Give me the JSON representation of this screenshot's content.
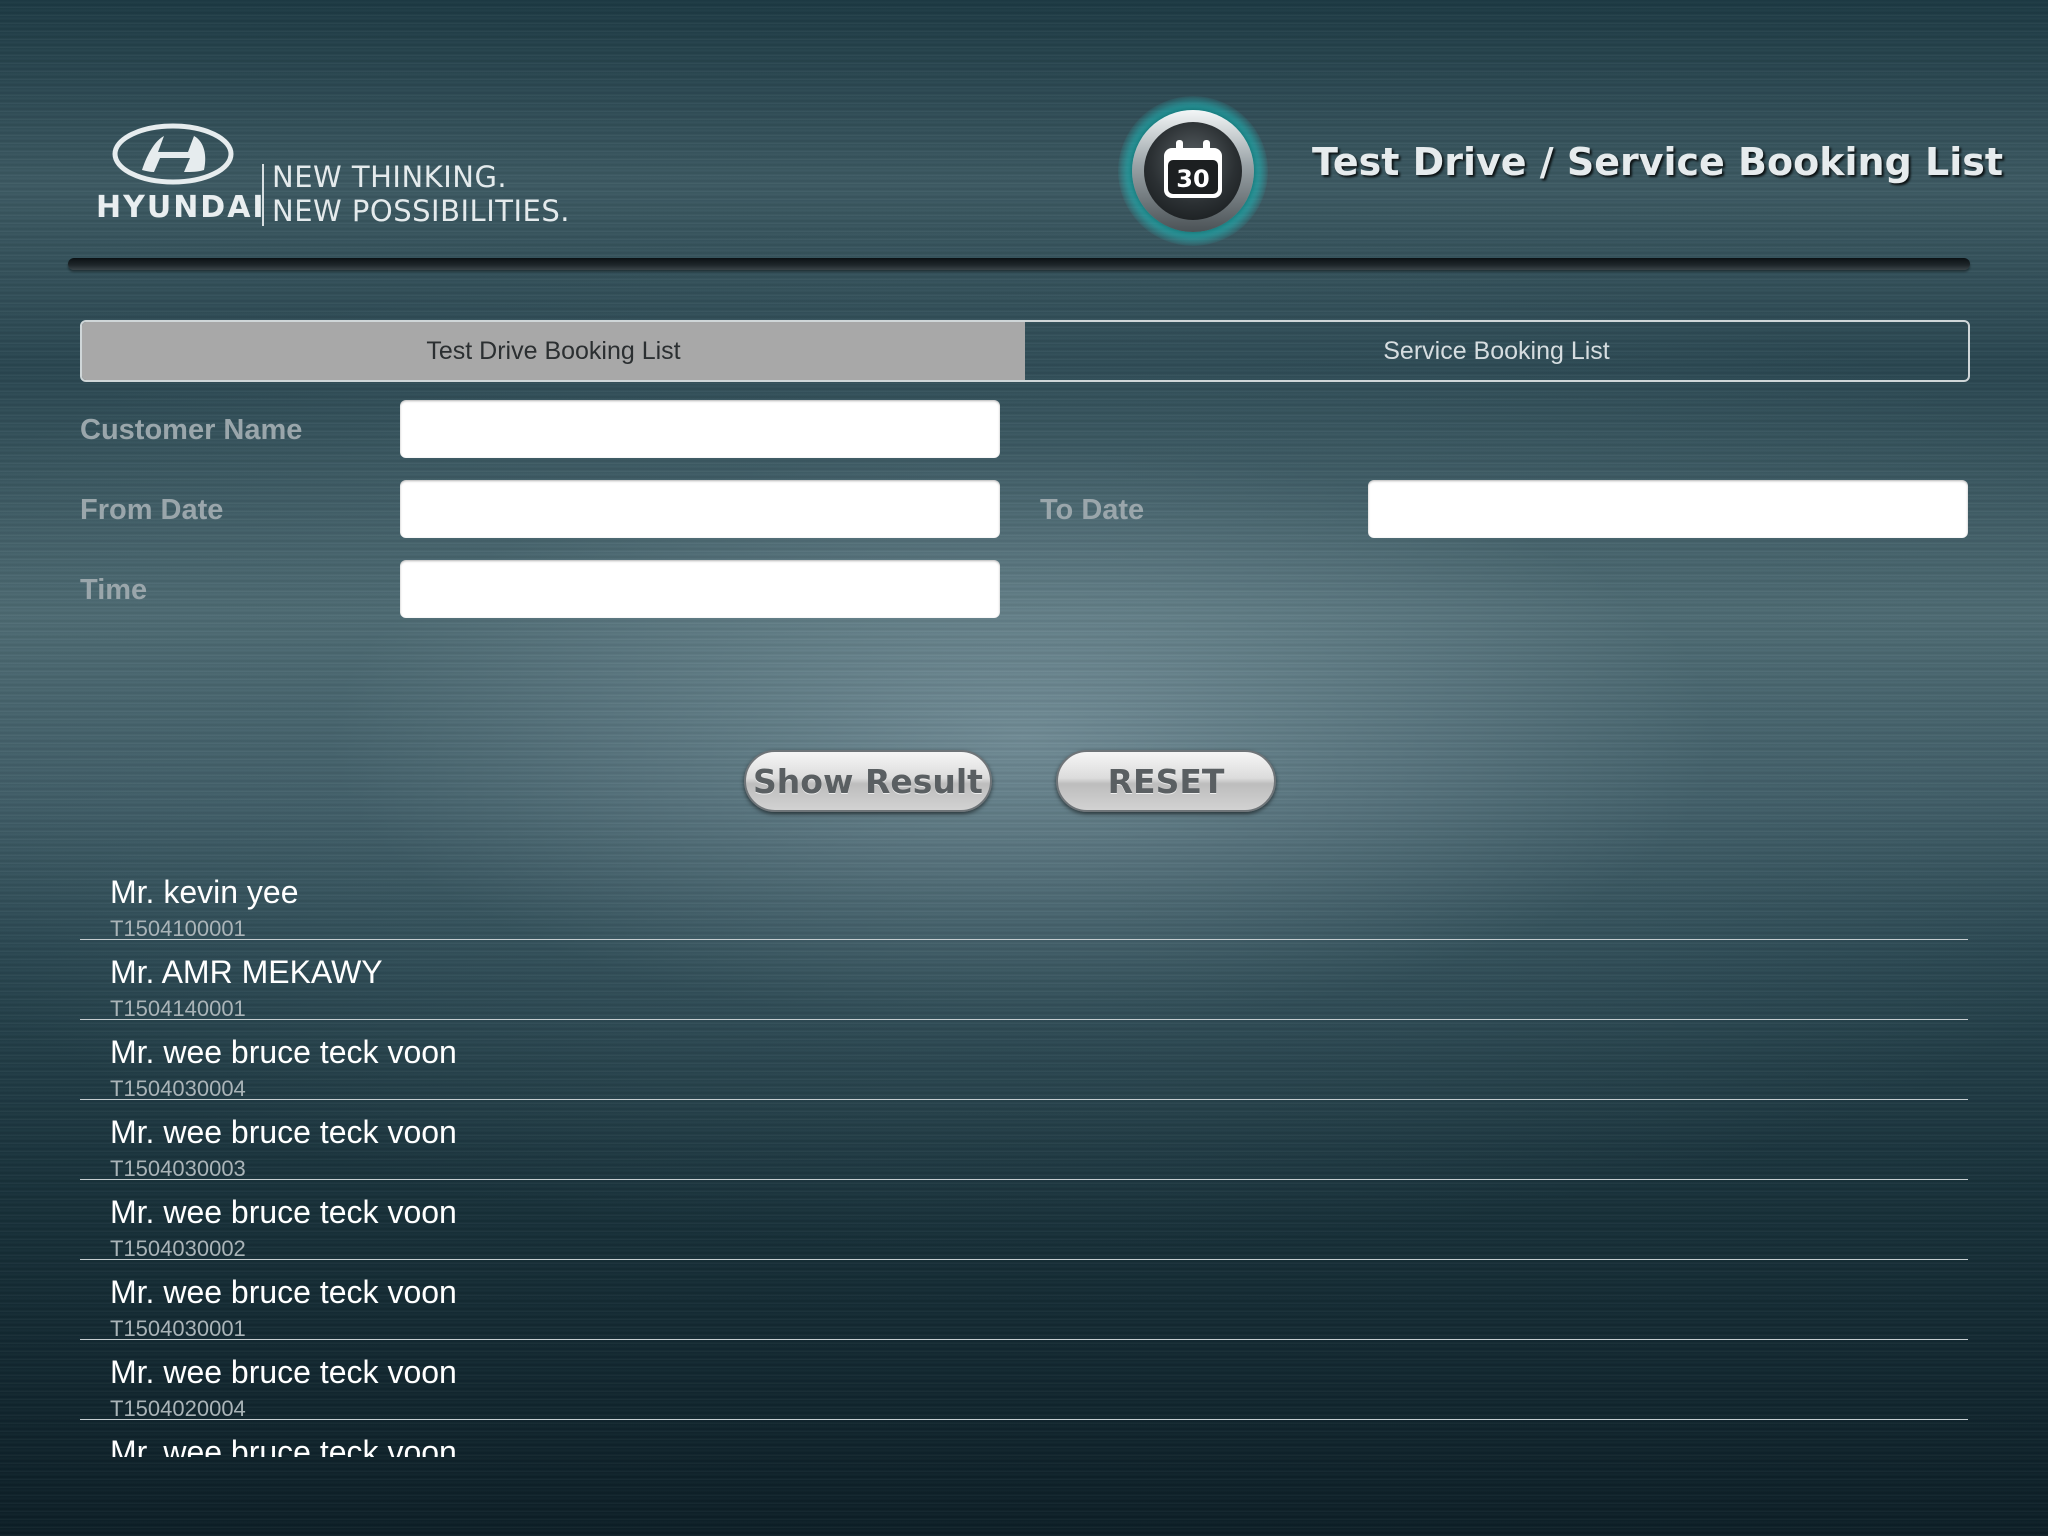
{
  "brand": {
    "wordmark": "HYUNDAI",
    "slogan_line1": "NEW THINKING.",
    "slogan_line2": "NEW POSSIBILITIES."
  },
  "header": {
    "title": "Test Drive / Service Booking List",
    "calendar_day": "30",
    "icon": "calendar-icon"
  },
  "tabs": [
    {
      "label": "Test Drive Booking List",
      "active": true
    },
    {
      "label": "Service Booking List",
      "active": false
    }
  ],
  "form": {
    "customer_name": {
      "label": "Customer Name",
      "value": ""
    },
    "from_date": {
      "label": "From Date",
      "value": ""
    },
    "to_date": {
      "label": "To Date",
      "value": ""
    },
    "time": {
      "label": "Time",
      "value": ""
    }
  },
  "buttons": {
    "show_result": "Show Result",
    "reset": "RESET"
  },
  "bookings": [
    {
      "name": "Mr. kevin yee",
      "code": "T1504100001"
    },
    {
      "name": "Mr. AMR MEKAWY",
      "code": "T1504140001"
    },
    {
      "name": "Mr. wee bruce teck voon",
      "code": "T1504030004"
    },
    {
      "name": "Mr. wee bruce teck voon",
      "code": "T1504030003"
    },
    {
      "name": "Mr. wee bruce teck voon",
      "code": "T1504030002"
    },
    {
      "name": "Mr. wee bruce teck voon",
      "code": "T1504030001"
    },
    {
      "name": "Mr. wee bruce teck voon",
      "code": "T1504020004"
    },
    {
      "name": "Mr. wee bruce teck voon",
      "code": ""
    }
  ],
  "colors": {
    "accent_glow": "#1edcdc",
    "active_tab": "#a8a8a8",
    "label": "#9aa6ab"
  }
}
